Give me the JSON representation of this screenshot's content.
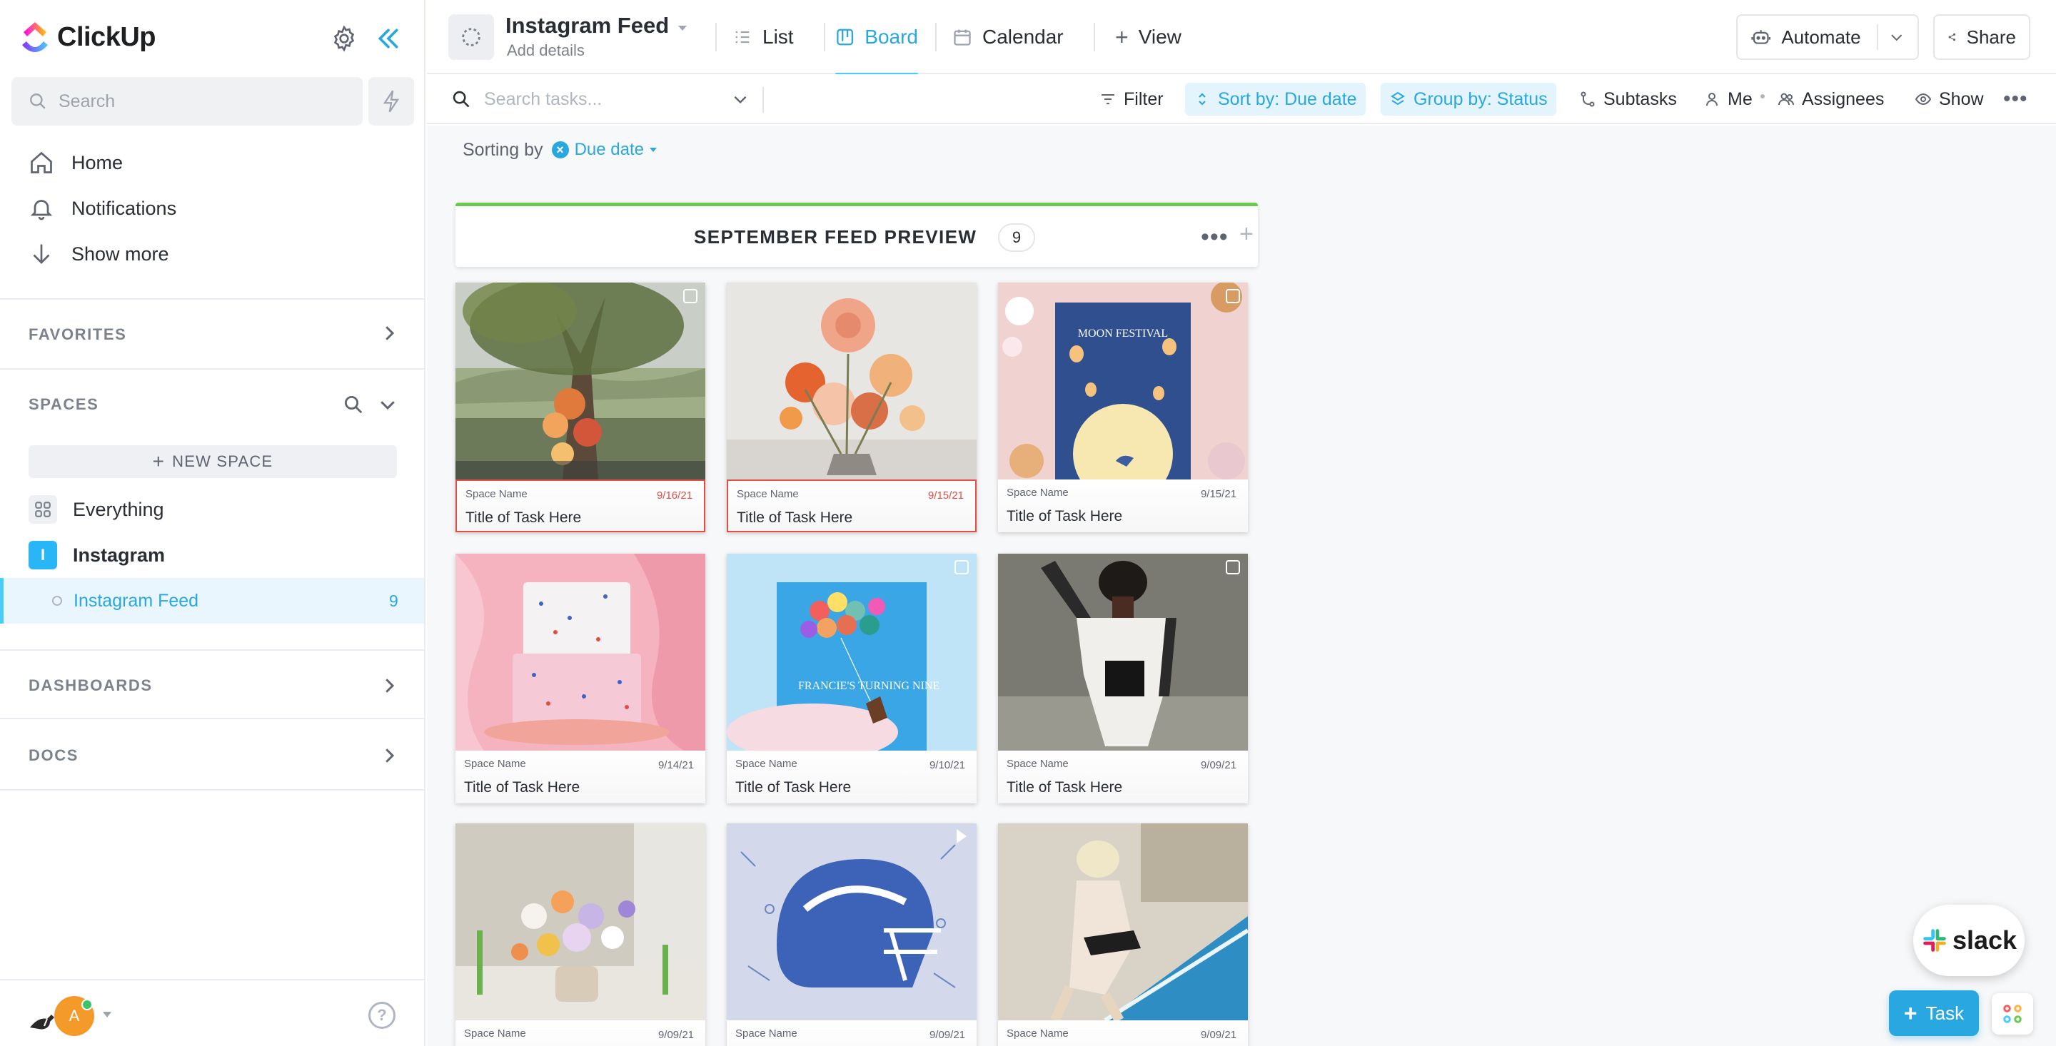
{
  "app": {
    "name": "ClickUp"
  },
  "sidebar": {
    "search_placeholder": "Search",
    "nav": [
      {
        "label": "Home",
        "icon": "home-icon"
      },
      {
        "label": "Notifications",
        "icon": "bell-icon"
      },
      {
        "label": "Show more",
        "icon": "arrow-down-icon"
      }
    ],
    "favorites_label": "FAVORITES",
    "spaces_label": "SPACES",
    "new_space_label": "NEW SPACE",
    "spaces": [
      {
        "label": "Everything",
        "icon": "grid-icon"
      },
      {
        "label": "Instagram",
        "icon_letter": "I",
        "color": "#29b6f6"
      }
    ],
    "active_list": {
      "label": "Instagram Feed",
      "count": "9"
    },
    "dashboards_label": "DASHBOARDS",
    "docs_label": "DOCS",
    "avatar_initial": "A",
    "help_label": "?"
  },
  "header": {
    "title": "Instagram Feed",
    "subtitle": "Add details",
    "views": [
      {
        "label": "List",
        "icon": "list-icon",
        "active": false
      },
      {
        "label": "Board",
        "icon": "board-icon",
        "active": true
      },
      {
        "label": "Calendar",
        "icon": "calendar-icon",
        "active": false
      }
    ],
    "add_view_label": "View",
    "automate_label": "Automate",
    "share_label": "Share"
  },
  "toolbar": {
    "search_placeholder": "Search tasks...",
    "filter_label": "Filter",
    "sort_label": "Sort by: Due date",
    "group_label": "Group by: Status",
    "subtasks_label": "Subtasks",
    "me_label": "Me",
    "assignees_label": "Assignees",
    "show_label": "Show"
  },
  "sorting": {
    "prefix": "Sorting by",
    "field": "Due date"
  },
  "group": {
    "title": "SEPTEMBER FEED PREVIEW",
    "count": "9",
    "status_color": "#6bc950"
  },
  "cards": [
    {
      "space": "Space Name",
      "title": "Title of Task Here",
      "date": "9/16/21",
      "overdue": true,
      "image": "tree-with-flowers"
    },
    {
      "space": "Space Name",
      "title": "Title of Task Here",
      "date": "9/15/21",
      "overdue": true,
      "image": "dahlia-bouquet"
    },
    {
      "space": "Space Name",
      "title": "Title of Task Here",
      "date": "9/15/21",
      "overdue": false,
      "image": "moon-festival-card",
      "image_caption": "MOON FESTIVAL"
    },
    {
      "space": "Space Name",
      "title": "Title of Task Here",
      "date": "9/14/21",
      "overdue": false,
      "image": "terrazzo-cake"
    },
    {
      "space": "Space Name",
      "title": "Title of Task Here",
      "date": "9/10/21",
      "overdue": false,
      "image": "balloon-birthday-card",
      "image_caption": "FRANCIE'S TURNING NINE"
    },
    {
      "space": "Space Name",
      "title": "Title of Task Here",
      "date": "9/09/21",
      "overdue": false,
      "image": "fashion-model"
    },
    {
      "space": "Space Name",
      "title": "",
      "date": "9/09/21",
      "overdue": false,
      "image": "wildflower-vase"
    },
    {
      "space": "Space Name",
      "title": "",
      "date": "9/09/21",
      "overdue": false,
      "image": "football-helmet"
    },
    {
      "space": "Space Name",
      "title": "",
      "date": "9/09/21",
      "overdue": false,
      "image": "poolside-vintage"
    }
  ],
  "floating": {
    "slack_label": "slack",
    "task_label": "Task"
  },
  "colors": {
    "accent": "#29a7e0",
    "overdue": "#e04f44",
    "status_green": "#6bc950"
  }
}
